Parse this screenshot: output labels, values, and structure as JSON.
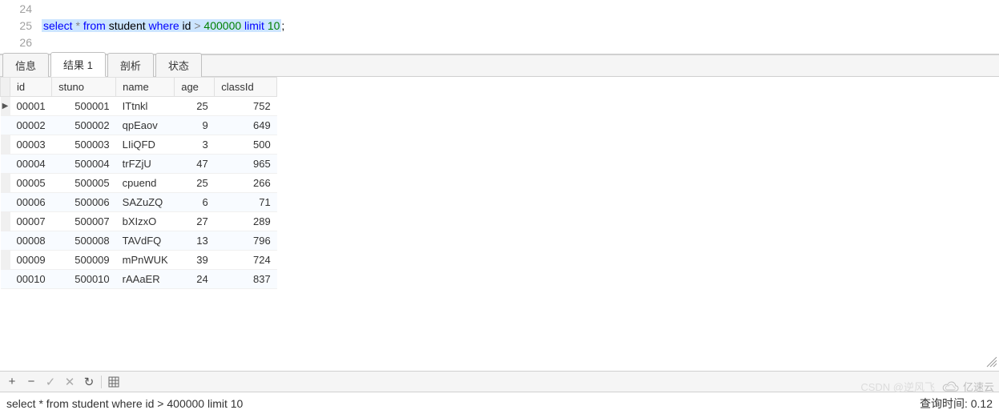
{
  "editor": {
    "lines": [
      {
        "num": "24",
        "content": ""
      },
      {
        "num": "25",
        "tokens": [
          "select",
          " * ",
          "from",
          " student ",
          "where",
          " id ",
          ">",
          " ",
          "400000",
          " ",
          "limit",
          " ",
          "10",
          ";"
        ]
      },
      {
        "num": "26",
        "content": ""
      }
    ]
  },
  "tabs": [
    {
      "label": "信息",
      "active": false
    },
    {
      "label": "结果 1",
      "active": true
    },
    {
      "label": "剖析",
      "active": false
    },
    {
      "label": "状态",
      "active": false
    }
  ],
  "table": {
    "columns": [
      "id",
      "stuno",
      "name",
      "age",
      "classId"
    ],
    "rows": [
      {
        "marker": "▶",
        "id": "00001",
        "stuno": "500001",
        "name": "ITtnkl",
        "age": "25",
        "classId": "752"
      },
      {
        "marker": "",
        "id": "00002",
        "stuno": "500002",
        "name": "qpEaov",
        "age": "9",
        "classId": "649"
      },
      {
        "marker": "",
        "id": "00003",
        "stuno": "500003",
        "name": "LIiQFD",
        "age": "3",
        "classId": "500"
      },
      {
        "marker": "",
        "id": "00004",
        "stuno": "500004",
        "name": "trFZjU",
        "age": "47",
        "classId": "965"
      },
      {
        "marker": "",
        "id": "00005",
        "stuno": "500005",
        "name": "cpuend",
        "age": "25",
        "classId": "266"
      },
      {
        "marker": "",
        "id": "00006",
        "stuno": "500006",
        "name": "SAZuZQ",
        "age": "6",
        "classId": "71"
      },
      {
        "marker": "",
        "id": "00007",
        "stuno": "500007",
        "name": "bXIzxO",
        "age": "27",
        "classId": "289"
      },
      {
        "marker": "",
        "id": "00008",
        "stuno": "500008",
        "name": "TAVdFQ",
        "age": "13",
        "classId": "796"
      },
      {
        "marker": "",
        "id": "00009",
        "stuno": "500009",
        "name": "mPnWUK",
        "age": "39",
        "classId": "724"
      },
      {
        "marker": "",
        "id": "00010",
        "stuno": "500010",
        "name": "rAAaER",
        "age": "24",
        "classId": "837"
      }
    ]
  },
  "toolbar": {
    "add": "+",
    "remove": "−",
    "confirm": "✓",
    "cancel": "✕",
    "refresh": "↻",
    "grid": "grid"
  },
  "status": {
    "query": "select * from student where id > 400000 limit 10",
    "time": "查询时间: 0.12"
  },
  "watermark": {
    "brand": "亿速云",
    "csdn": "CSDN @逆风飞"
  }
}
